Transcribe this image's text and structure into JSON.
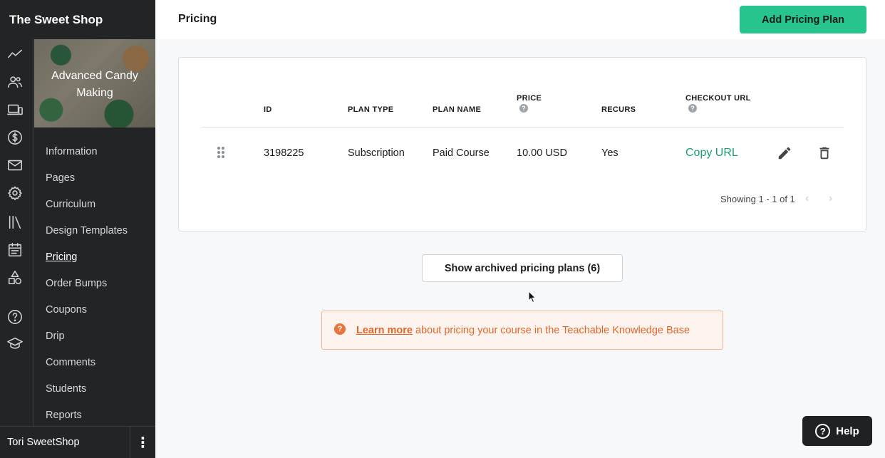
{
  "sidebar": {
    "school_name": "The Sweet Shop",
    "course_title": "Advanced Candy Making",
    "rail_icons": [
      "stats-icon",
      "users-icon",
      "devices-icon",
      "dollar-icon",
      "mail-icon",
      "gear-icon",
      "library-icon",
      "calendar-icon",
      "shapes-icon",
      "help-circle-icon",
      "graduation-cap-icon"
    ],
    "items": [
      {
        "label": "Information"
      },
      {
        "label": "Pages"
      },
      {
        "label": "Curriculum"
      },
      {
        "label": "Design Templates"
      },
      {
        "label": "Pricing"
      },
      {
        "label": "Order Bumps"
      },
      {
        "label": "Coupons"
      },
      {
        "label": "Drip"
      },
      {
        "label": "Comments"
      },
      {
        "label": "Students"
      },
      {
        "label": "Reports"
      }
    ],
    "active_item": "Pricing",
    "user_name": "Tori SweetShop",
    "user_menu_glyph": "⋮"
  },
  "header": {
    "title": "Pricing",
    "add_button": "Add Pricing Plan"
  },
  "table": {
    "columns": {
      "id": "ID",
      "plan_type": "PLAN TYPE",
      "plan_name": "PLAN NAME",
      "price": "PRICE",
      "recurs": "RECURS",
      "checkout_url": "CHECKOUT URL"
    },
    "rows": [
      {
        "id": "3198225",
        "plan_type": "Subscription",
        "plan_name": "Paid Course",
        "price": "10.00 USD",
        "recurs": "Yes",
        "checkout_url": "Copy URL"
      }
    ],
    "pagination": "Showing 1 - 1 of 1",
    "prev_glyph": "‹",
    "next_glyph": "›"
  },
  "archived_button": "Show archived pricing plans (6)",
  "info": {
    "icon_glyph": "?",
    "link": "Learn more",
    "text": " about pricing your course in the Teachable Knowledge Base"
  },
  "help": {
    "label": "Help",
    "icon_glyph": "?"
  },
  "colors": {
    "sidebar_bg": "#222426",
    "accent_green": "#27c48e",
    "link_green": "#1a9d73",
    "info_orange": "#e0672c",
    "info_bg": "#fdf3ee"
  }
}
